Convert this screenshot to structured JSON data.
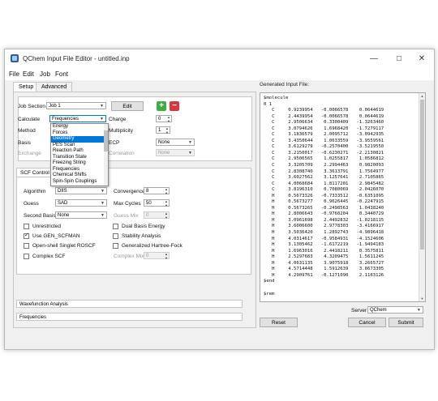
{
  "window": {
    "title": "QChem Input File Editor - untitled.inp",
    "min_glyph": "—",
    "max_glyph": "□",
    "close_glyph": "✕"
  },
  "menu": [
    "File",
    "Edit",
    "Job",
    "Font"
  ],
  "tabs": [
    "Setup",
    "Advanced"
  ],
  "setup": {
    "job_section_label": "Job Section",
    "job_section_value": "Job 1",
    "edit_label": "Edit",
    "add_glyph": "+",
    "remove_glyph": "−",
    "calculate_label": "Calculate",
    "calculate_value": "Frequencies",
    "method_label": "Method",
    "basis_label": "Basis",
    "exchange_label": "Exchange",
    "charge_label": "Charge",
    "charge_value": "0",
    "multiplicity_label": "Multiplicity",
    "multiplicity_value": "1",
    "ecp_label": "ECP",
    "ecp_value": "None",
    "correlation_label": "Correlation",
    "correlation_value": "None"
  },
  "calc_dropdown": {
    "options": [
      "Energy",
      "Forces",
      "Geometry",
      "PES Scan",
      "Reaction Path",
      "Transition State",
      "Freezing String",
      "Frequencies",
      "Chemical Shifts",
      "Spin-Spin Couplings"
    ],
    "selected_index": 2
  },
  "scf": {
    "title": "SCF Control",
    "algorithm_label": "Algorithm",
    "algorithm_value": "DIIS",
    "convergence_label": "Convergence",
    "convergence_value": "8",
    "guess_label": "Guess",
    "guess_value": "SAD",
    "max_cycles_label": "Max Cycles",
    "max_cycles_value": "50",
    "second_basis_label": "Second Basis",
    "second_basis_value": "None",
    "guess_mix_label": "Guess Mix",
    "guess_mix_value": "0",
    "unrestricted_label": "Unrestricted",
    "use_gen_scfman_label": "Use GEN_SCFMAN",
    "open_shell_label": "Open-shell Singlet ROSCF",
    "complex_scf_label": "Complex SCF",
    "dual_basis_label": "Dual Basis Energy",
    "stability_label": "Stability Analysis",
    "gen_hf_label": "Generalized Hartree-Fock",
    "complex_mix_label": "Complex Mix",
    "complex_mix_value": "0"
  },
  "sections": {
    "wavefunction": "Wavefunction Analysis",
    "frequencies": "Frequencies"
  },
  "generated": {
    "title": "Generated Input File:",
    "text": "$molecule\n0 1\n   C     0.9239954   -0.0066578    0.0644619\n   C     2.4439954   -0.0066578    0.0644619\n   C     2.9506634    0.3300409   -1.3263460\n   C     3.0794626    1.6968420   -1.7279117\n   C     3.1836579    2.0095712   -3.0942935\n   C     3.4350644    1.0633559   -3.9559561\n   C     3.6129279   -0.2570400   -3.5219550\n   C     3.2150017   -0.6230271   -2.2130821\n   C     2.9506565    1.0255817    1.0586812\n   C     3.3205709    2.2994463    0.9820093\n   C     2.8308740    3.3613791    1.7564977\n   C     3.6027562    3.1257641    2.7105865\n   C     4.0068684    1.8117201    2.9845482\n   C     3.8196310    0.7080069    2.0426070\n   H     0.5673326   -0.7333512   -0.6351095\n   H     0.5673277    0.9626445   -0.2247915\n   H     0.5673265   -0.2498563    1.0438240\n   H     2.8006643   -0.9760204    0.3440729\n   H     3.0961698    2.4492832   -1.0218115\n   H     3.6006600    2.9778303   -3.4166917\n   H     3.5036420    1.2892743   -4.9896418\n   H     4.0314617   -0.9584931   -4.1524606\n   H     3.1305462   -1.6172219   -1.9494183\n   H     1.6963016    2.4418211    0.3575811\n   H     2.5297683    4.3209475    1.5611245\n   H     4.0631135    3.9075918    3.2665727\n   H     4.5714448    1.5912639    3.8673305\n   H     4.2909761   -0.1271090    2.1163126\n$end\n\n$rem"
  },
  "footer": {
    "server_label": "Server",
    "server_value": "QChem",
    "reset_label": "Reset",
    "cancel_label": "Cancel",
    "submit_label": "Submit"
  }
}
